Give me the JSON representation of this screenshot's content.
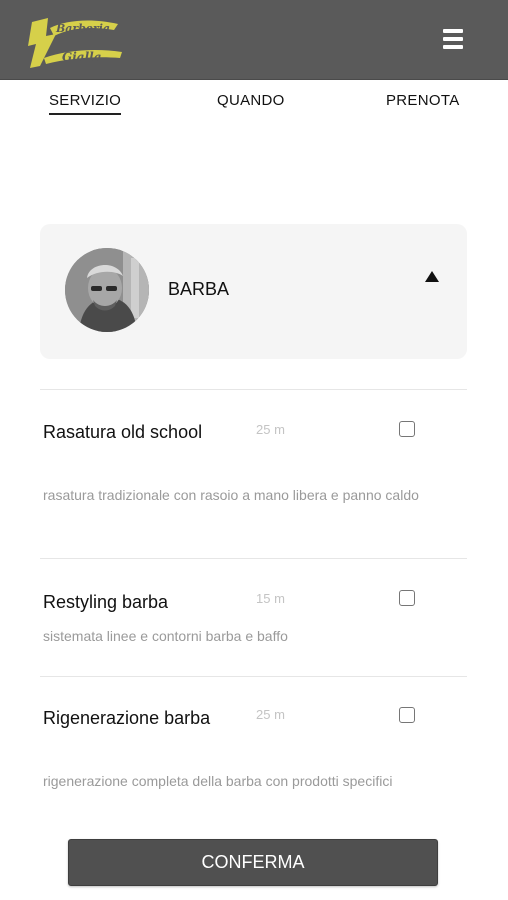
{
  "header": {
    "logo_text_line1": "Barberia",
    "logo_text_line2": "Gialla",
    "menu_icon": "hamburger-icon",
    "background_color": "#5a5a5a",
    "logo_color": "#d6d04a"
  },
  "steps": [
    {
      "label": "SERVIZIO",
      "active": true
    },
    {
      "label": "QUANDO",
      "active": false
    },
    {
      "label": "PRENOTA",
      "active": false
    }
  ],
  "category": {
    "name": "BARBA",
    "expanded_icon": "caret-up-icon"
  },
  "services": [
    {
      "name": "Rasatura old school",
      "duration": "25 m",
      "description": "rasatura tradizionale con rasoio a mano libera e panno caldo",
      "checked": false
    },
    {
      "name": "Restyling barba",
      "duration": "15 m",
      "description": "sistemata linee e contorni barba e baffo",
      "checked": false
    },
    {
      "name": "Rigenerazione barba",
      "duration": "25 m",
      "description": "rigenerazione completa della barba con prodotti specifici",
      "checked": false
    }
  ],
  "confirm_label": "CONFERMA"
}
